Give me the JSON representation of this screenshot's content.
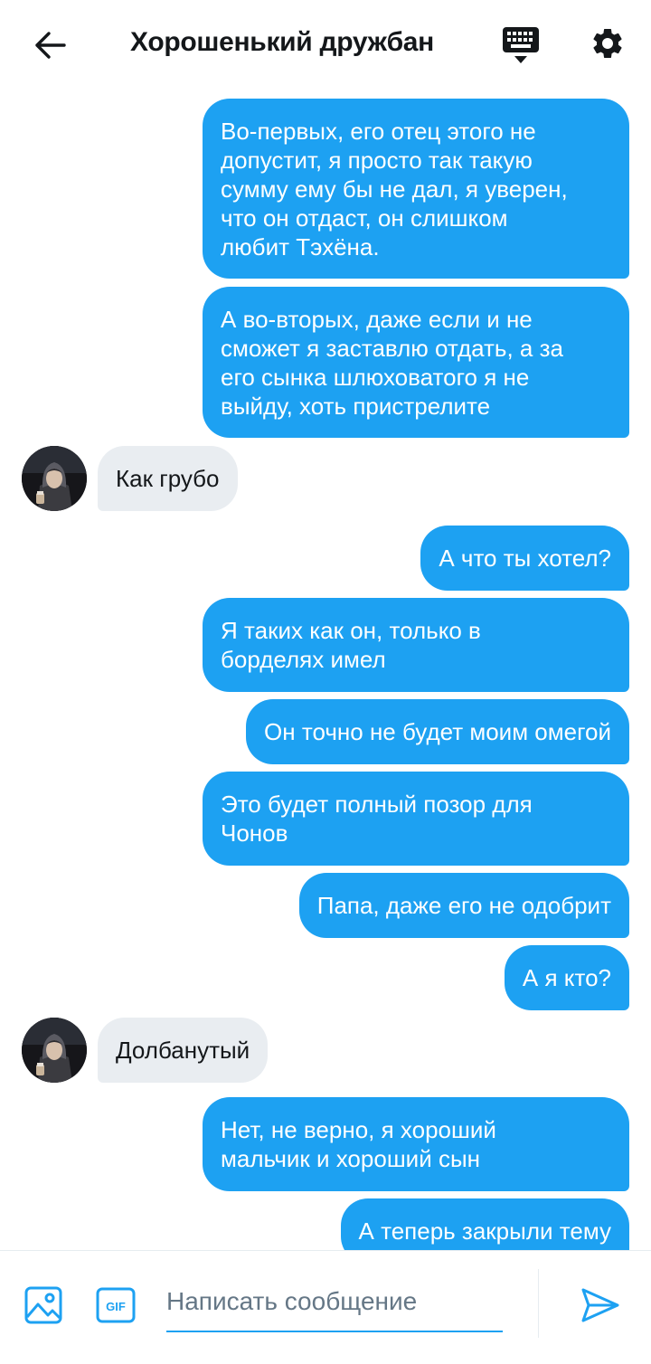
{
  "header": {
    "title": "Хорошенький дружбан",
    "back_icon": "arrow-left-icon",
    "keyboard_icon": "keyboard-icon",
    "settings_icon": "gear-icon"
  },
  "messages": [
    {
      "dir": "out",
      "text": "Во-первых, его отец этого не\nдопустит, я просто так такую\nсумму ему бы не дал, я уверен,\nчто он отдаст, он слишком\nлюбит Тэхёна."
    },
    {
      "dir": "out",
      "text": "А во-вторых, даже если и не\nсможет я заставлю отдать, а за\nего сынка шлюховатого я не\nвыйду, хоть пристрелите"
    },
    {
      "dir": "in",
      "text": "Как грубо"
    },
    {
      "dir": "out",
      "text": "А что ты хотел?"
    },
    {
      "dir": "out",
      "text": "Я таких как он, только в\nборделях имел"
    },
    {
      "dir": "out",
      "text": "Он точно не будет моим омегой"
    },
    {
      "dir": "out",
      "text": "Это будет полный позор для\nЧонов"
    },
    {
      "dir": "out",
      "text": "Папа, даже его не одобрит"
    },
    {
      "dir": "out",
      "text": "А я кто?"
    },
    {
      "dir": "in",
      "text": "Долбанутый"
    },
    {
      "dir": "out",
      "text": "Нет, не верно, я хороший\nмальчик и хороший сын"
    },
    {
      "dir": "out",
      "text": "А теперь закрыли тему"
    }
  ],
  "composer": {
    "placeholder": "Написать сообщение",
    "gif_label": "GIF"
  },
  "colors": {
    "accent": "#1da1f2",
    "incoming_bubble": "#e9edf1",
    "text": "#14171a"
  }
}
